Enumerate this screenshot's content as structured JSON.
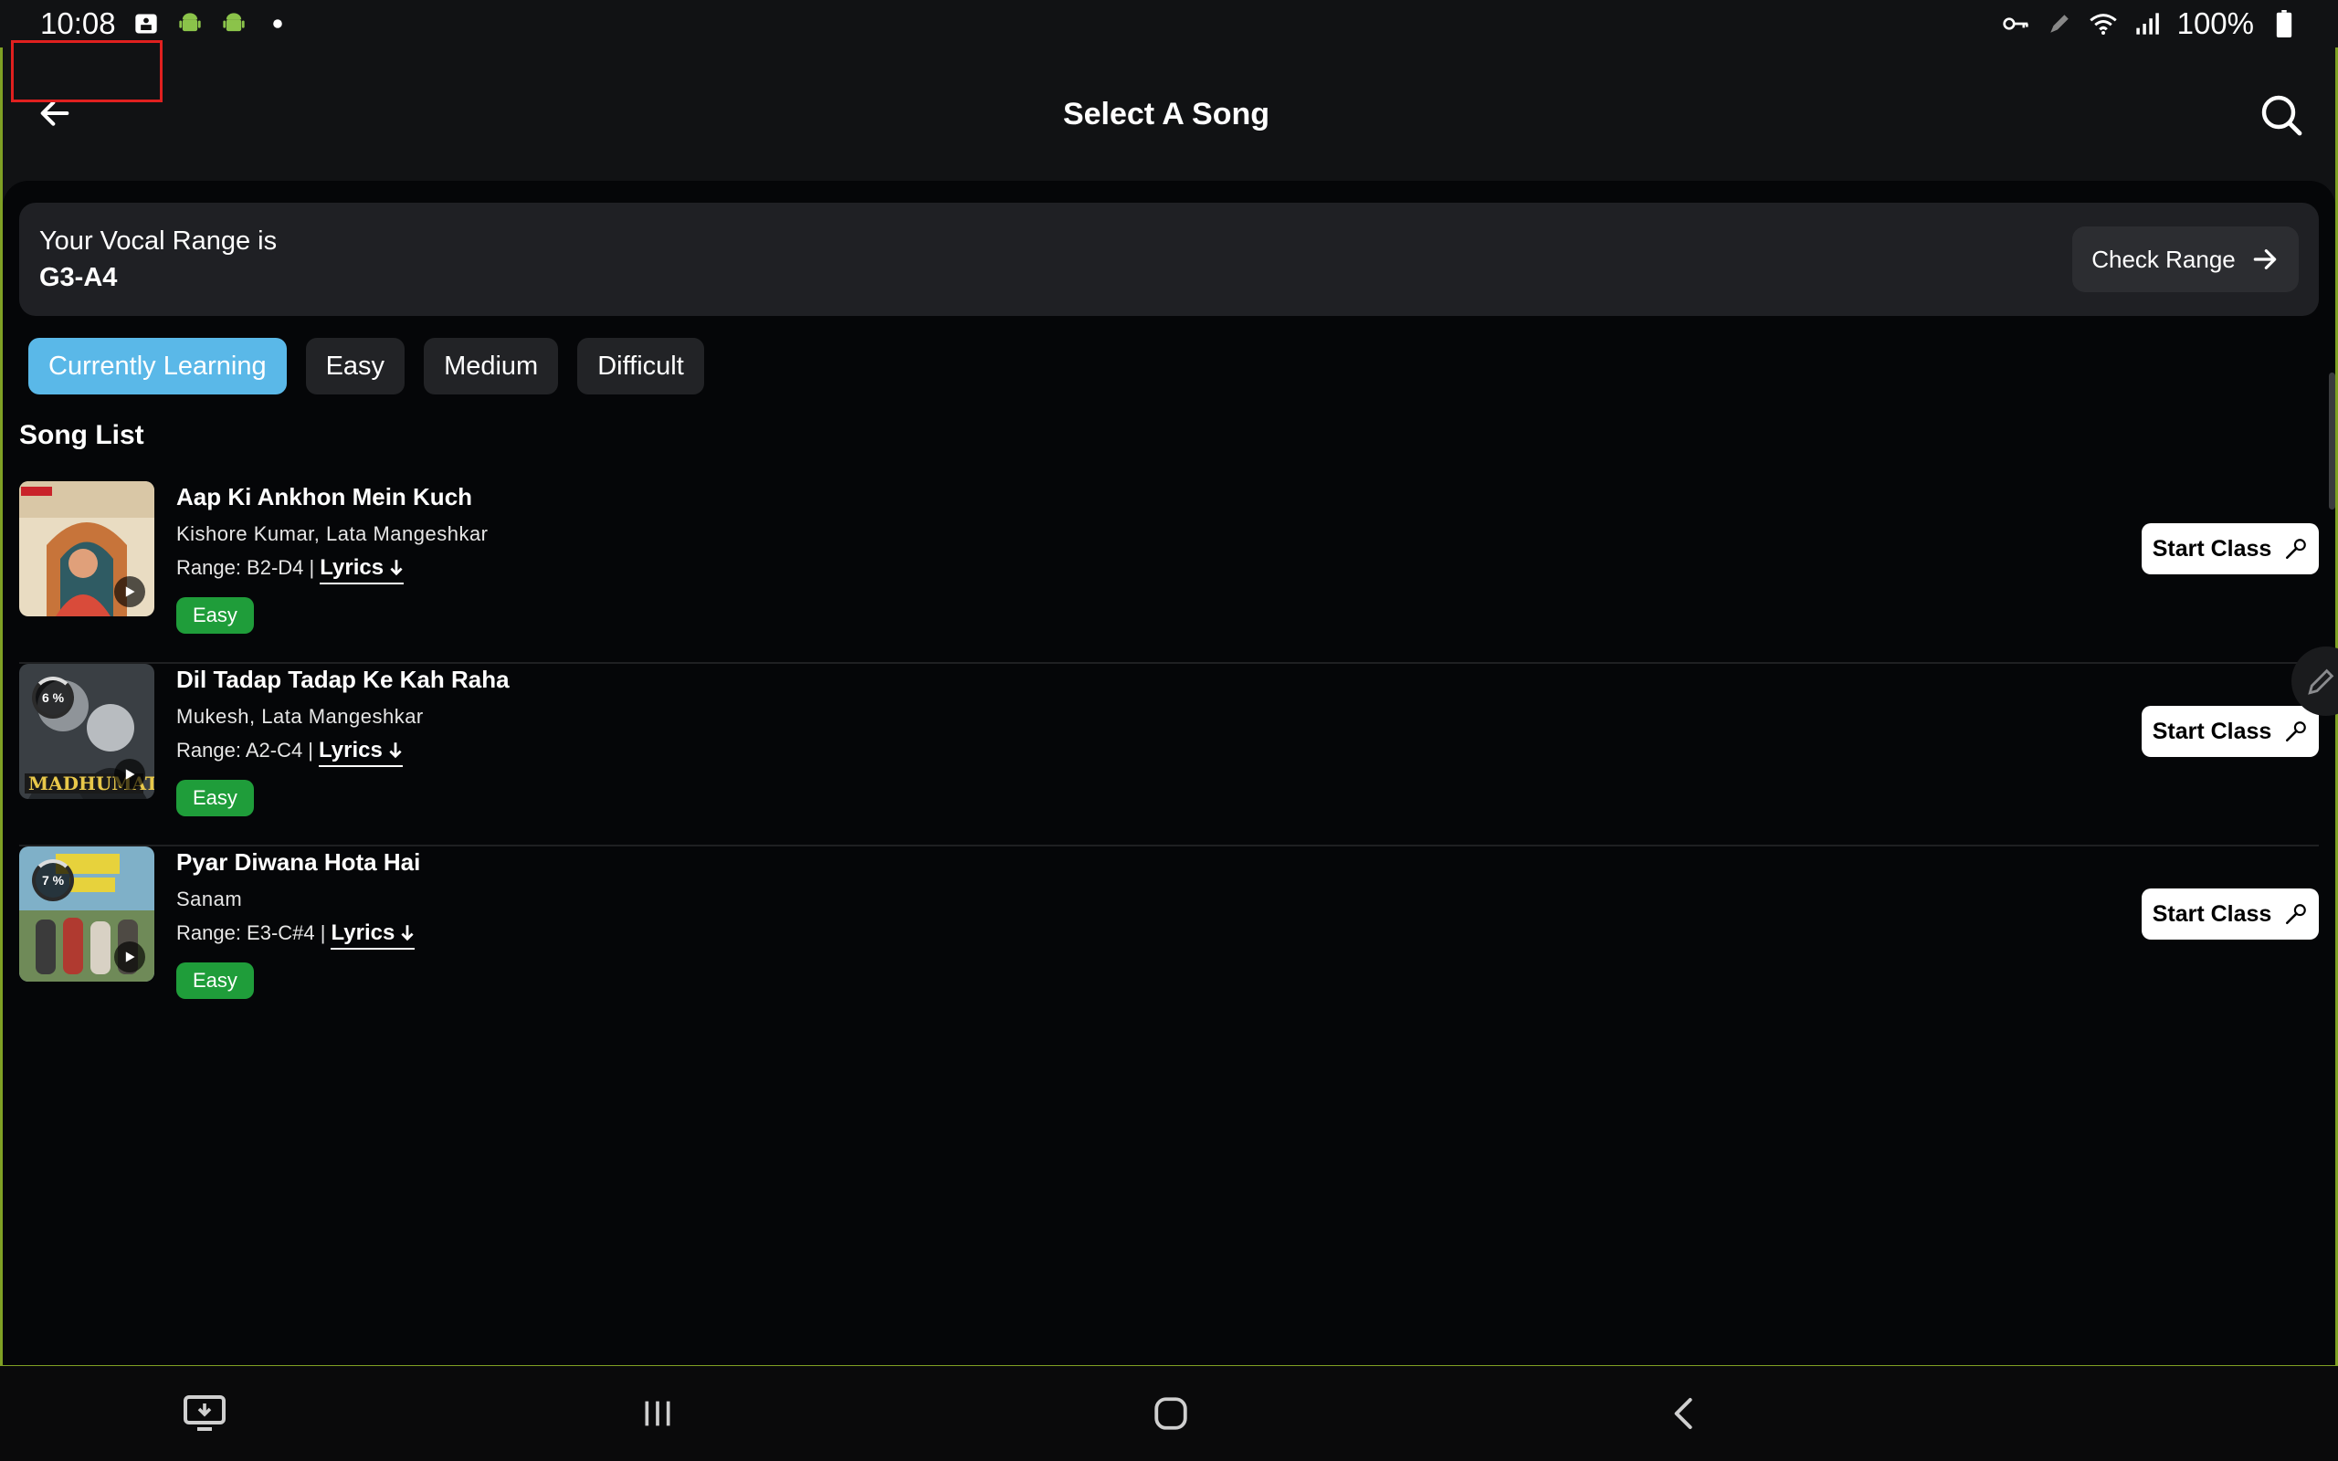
{
  "status_bar": {
    "time": "10:08",
    "battery": "100%",
    "left_icons": [
      "screenshot-icon",
      "android-icon",
      "android-icon",
      "dot-icon"
    ],
    "right_icons": [
      "key-icon",
      "pen-icon",
      "wifi-icon",
      "signal-icon",
      "battery-icon"
    ]
  },
  "header": {
    "title": "Select A Song"
  },
  "vocal_range": {
    "label": "Your Vocal Range is",
    "value": "G3-A4",
    "check_label": "Check Range"
  },
  "filters": [
    {
      "label": "Currently Learning",
      "active": true
    },
    {
      "label": "Easy",
      "active": false
    },
    {
      "label": "Medium",
      "active": false
    },
    {
      "label": "Difficult",
      "active": false
    }
  ],
  "song_list": {
    "title": "Song List",
    "songs": [
      {
        "title": "Aap Ki Ankhon Mein Kuch",
        "artist": "Kishore Kumar, Lata Mangeshkar",
        "range": "Range: B2-D4 |",
        "lyrics": "Lyrics",
        "level": "Easy",
        "progress": "",
        "start_label": "Start Class"
      },
      {
        "title": "Dil Tadap Tadap Ke Kah Raha",
        "artist": "Mukesh, Lata Mangeshkar",
        "range": "Range: A2-C4 |",
        "lyrics": "Lyrics",
        "level": "Easy",
        "progress": "6 %",
        "start_label": "Start Class"
      },
      {
        "title": "Pyar Diwana Hota Hai",
        "artist": "Sanam",
        "range": "Range: E3-C#4 |",
        "lyrics": "Lyrics",
        "level": "Easy",
        "progress": "7 %",
        "start_label": "Start Class"
      }
    ]
  },
  "colors": {
    "accent_blue": "#5ab8e8",
    "easy_green": "#1f9d3a",
    "frame_border": "#7fa024",
    "highlight_red": "#e0201f"
  }
}
